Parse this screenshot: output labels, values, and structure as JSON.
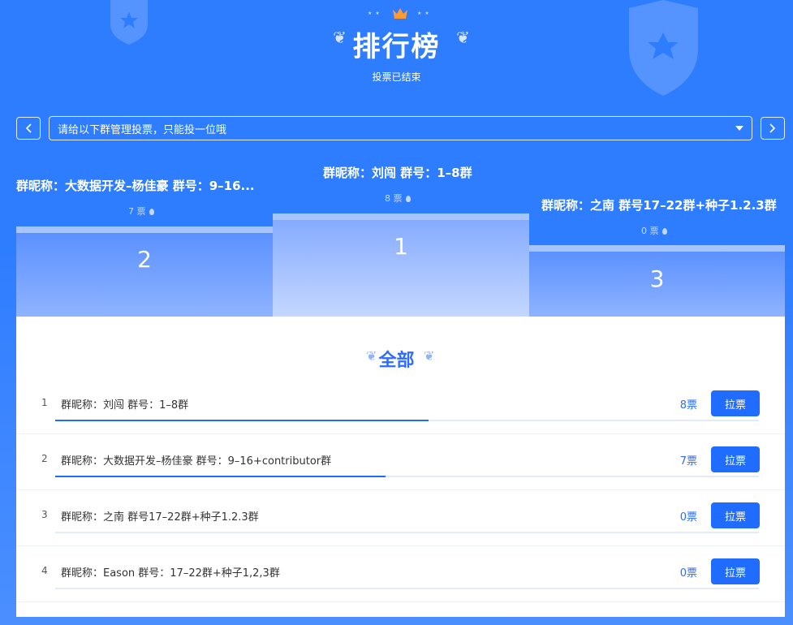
{
  "header": {
    "title": "排行榜",
    "status": "投票已结束",
    "icons": [
      "crown-icon",
      "laurel-icon",
      "shield-star-icon"
    ]
  },
  "selector": {
    "value": "请给以下群管理投票，只能投一位哦",
    "prev_icon": "chevron-left-icon",
    "next_icon": "chevron-right-icon",
    "caret_icon": "caret-down-icon"
  },
  "podium": {
    "first": {
      "rank": "1",
      "name": "群昵称：刘闯 群号：1–8群",
      "votes": "8 票"
    },
    "second": {
      "rank": "2",
      "name": "群昵称：大数据开发–杨佳豪 群号：9–16...",
      "votes": "7 票"
    },
    "third": {
      "rank": "3",
      "name": "群昵称：之南 群号17–22群+种子1.2.3群",
      "votes": "0 票"
    }
  },
  "all_section": {
    "title": "全部"
  },
  "rows": [
    {
      "rank": "1",
      "name": "群昵称：刘闯 群号：1–8群",
      "votes": "8票",
      "share": 0.53,
      "action": "拉票"
    },
    {
      "rank": "2",
      "name": "群昵称：大数据开发–杨佳豪 群号：9–16+contributor群",
      "votes": "7票",
      "share": 0.47,
      "action": "拉票"
    },
    {
      "rank": "3",
      "name": "群昵称：之南 群号17–22群+种子1.2.3群",
      "votes": "0票",
      "share": 0,
      "action": "拉票"
    },
    {
      "rank": "4",
      "name": "群昵称：Eason 群号：17–22群+种子1,2,3群",
      "votes": "0票",
      "share": 0,
      "action": "拉票"
    }
  ],
  "colors": {
    "brand": "#2f7dff",
    "accent": "#1f6cff",
    "panel": "#ffffff"
  }
}
